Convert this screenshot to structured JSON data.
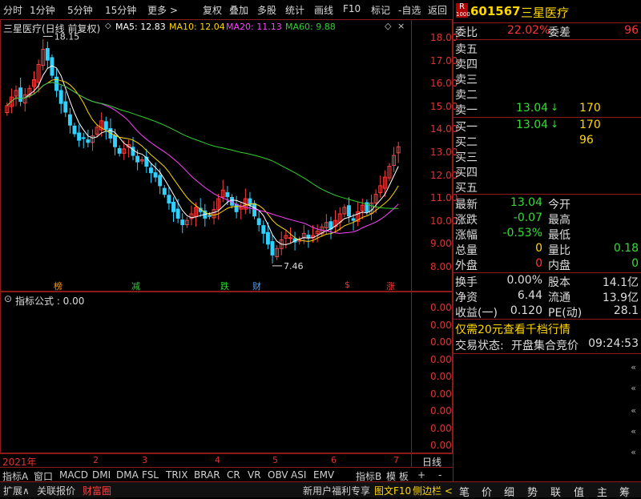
{
  "toolbar": {
    "periods": [
      "分时",
      "1分钟",
      "5分钟",
      "15分钟",
      "更多 >"
    ],
    "actions": [
      "复权",
      "叠加",
      "多股",
      "统计",
      "画线",
      "F10",
      "标记",
      "-自选",
      "返回"
    ]
  },
  "main_chart": {
    "title": "三星医疗(日线 前复权)",
    "ma": [
      {
        "label": "MA5: 12.83",
        "color": "#ffffff"
      },
      {
        "label": "MA10: 12.04",
        "color": "#ffd700"
      },
      {
        "label": "MA20: 11.13",
        "color": "#ff40ff"
      },
      {
        "label": "MA60: 9.88",
        "color": "#30d030"
      }
    ],
    "high_label": "18.15",
    "low_label": "7.46",
    "signals": [
      {
        "text": "榜",
        "color": "#ff9900"
      },
      {
        "text": "减",
        "color": "#33cc33"
      },
      {
        "text": "跌",
        "color": "#33cc33"
      },
      {
        "text": "财",
        "color": "#4aa3ff"
      },
      {
        "text": "$",
        "color": "#ff3333"
      },
      {
        "text": "涨",
        "color": "#ff3333"
      }
    ]
  },
  "chart_data": {
    "type": "candlestick",
    "yticks": [
      "18.00",
      "17.00",
      "16.00",
      "15.00",
      "14.00",
      "13.00",
      "12.00",
      "11.00",
      "10.00",
      "9.00",
      "8.00"
    ],
    "ylim": [
      7.2,
      18.3
    ],
    "xticks": [
      "2021年",
      "2",
      "3",
      "4",
      "5",
      "6",
      "7"
    ],
    "closes": [
      14.9,
      15.3,
      15.6,
      15.1,
      15.4,
      15.7,
      16.1,
      16.8,
      17.5,
      17.0,
      16.3,
      15.6,
      15.0,
      14.6,
      14.0,
      13.6,
      13.3,
      13.4,
      13.2,
      13.5,
      13.9,
      14.2,
      13.8,
      13.4,
      13.0,
      12.7,
      12.9,
      13.1,
      12.6,
      12.3,
      12.4,
      12.1,
      11.8,
      11.6,
      11.2,
      10.8,
      10.4,
      10.0,
      9.7,
      9.4,
      9.6,
      9.9,
      10.2,
      10.0,
      9.7,
      9.8,
      10.1,
      10.6,
      11.0,
      10.7,
      10.3,
      10.0,
      10.2,
      10.6,
      10.3,
      9.8,
      9.4,
      9.0,
      8.5,
      8.0,
      8.3,
      8.7,
      8.9,
      8.8,
      8.6,
      8.7,
      9.0,
      8.8,
      8.9,
      9.1,
      9.3,
      9.5,
      9.2,
      9.6,
      9.9,
      10.2,
      9.8,
      9.6,
      10.0,
      10.3,
      10.0,
      10.4,
      10.8,
      11.2,
      11.6,
      12.1,
      12.6,
      13.0
    ],
    "ma": {
      "MA5": 12.83,
      "MA10": 12.04,
      "MA20": 11.13,
      "MA60": 9.88
    }
  },
  "sub_chart": {
    "title": "指标公式 : 0.00",
    "yticks": [
      "0.00",
      "0.00",
      "0.00",
      "0.00",
      "0.00",
      "0.00",
      "0.00",
      "0.00",
      "0.00"
    ]
  },
  "axis_footer": {
    "x_start": "2021年",
    "months": [
      "2",
      "3",
      "4",
      "5",
      "6",
      "7"
    ],
    "period": "日线"
  },
  "indicator_tabs": [
    "指标A",
    "窗口",
    "MACD",
    "DMI",
    "DMA",
    "FSL",
    "TRIX",
    "BRAR",
    "CR",
    "VR",
    "OBV",
    "ASI",
    "EMV",
    "指标B",
    "模 板",
    "+",
    "-"
  ],
  "status_bar": [
    "扩展∧",
    "关联报价",
    "财富圈",
    "新用户福利专享",
    "图文F10",
    "侧边栏 <"
  ],
  "right_panel": {
    "icon": "R",
    "code": "601567",
    "name": "三星医疗",
    "wei_bi_label": "委比",
    "wei_bi": "22.02%",
    "wei_cha_label": "委差",
    "wei_cha": "96",
    "asks": [
      {
        "label": "卖五",
        "price": "",
        "vol": ""
      },
      {
        "label": "卖四",
        "price": "",
        "vol": ""
      },
      {
        "label": "卖三",
        "price": "",
        "vol": ""
      },
      {
        "label": "卖二",
        "price": "",
        "vol": ""
      },
      {
        "label": "卖一",
        "price": "13.04",
        "vol": "170"
      }
    ],
    "bids": [
      {
        "label": "买一",
        "price": "13.04",
        "vol": "170"
      },
      {
        "label": "买二",
        "price": "",
        "vol": "96"
      },
      {
        "label": "买三",
        "price": "",
        "vol": ""
      },
      {
        "label": "买四",
        "price": "",
        "vol": ""
      },
      {
        "label": "买五",
        "price": "",
        "vol": ""
      }
    ],
    "stats": [
      {
        "l1": "最新",
        "v1": "13.04",
        "c1": "#33dd33",
        "l2": "今开",
        "v2": "",
        "c2": "#fff"
      },
      {
        "l1": "涨跌",
        "v1": "-0.07",
        "c1": "#33dd33",
        "l2": "最高",
        "v2": "",
        "c2": "#fff"
      },
      {
        "l1": "涨幅",
        "v1": "-0.53%",
        "c1": "#33dd33",
        "l2": "最低",
        "v2": "",
        "c2": "#fff"
      },
      {
        "l1": "总量",
        "v1": "0",
        "c1": "#ffd700",
        "l2": "量比",
        "v2": "0.18",
        "c2": "#33dd33"
      },
      {
        "l1": "外盘",
        "v1": "0",
        "c1": "#ff3333",
        "l2": "内盘",
        "v2": "0",
        "c2": "#33dd33"
      }
    ],
    "finance": [
      {
        "l1": "换手",
        "v1": "0.00%",
        "l2": "股本",
        "v2": "14.1亿"
      },
      {
        "l1": "净资",
        "v1": "6.44",
        "l2": "流通",
        "v2": "13.9亿"
      },
      {
        "l1": "收益(一)",
        "v1": "0.120",
        "l2": "PE(动)",
        "v2": "28.1"
      }
    ],
    "promo": "仅需20元查看千档行情",
    "trade_status_label": "交易状态:",
    "trade_status": "开盘集合竞价",
    "trade_time": "09:24:53",
    "bottom_tabs": [
      "笔",
      "价",
      "细",
      "势",
      "联",
      "值",
      "主",
      "筹"
    ]
  },
  "colors": {
    "up": "#ff3333",
    "down": "#33dd33",
    "border": "#8b1a1a",
    "axis": "#dd3333",
    "gold": "#ffd700"
  }
}
